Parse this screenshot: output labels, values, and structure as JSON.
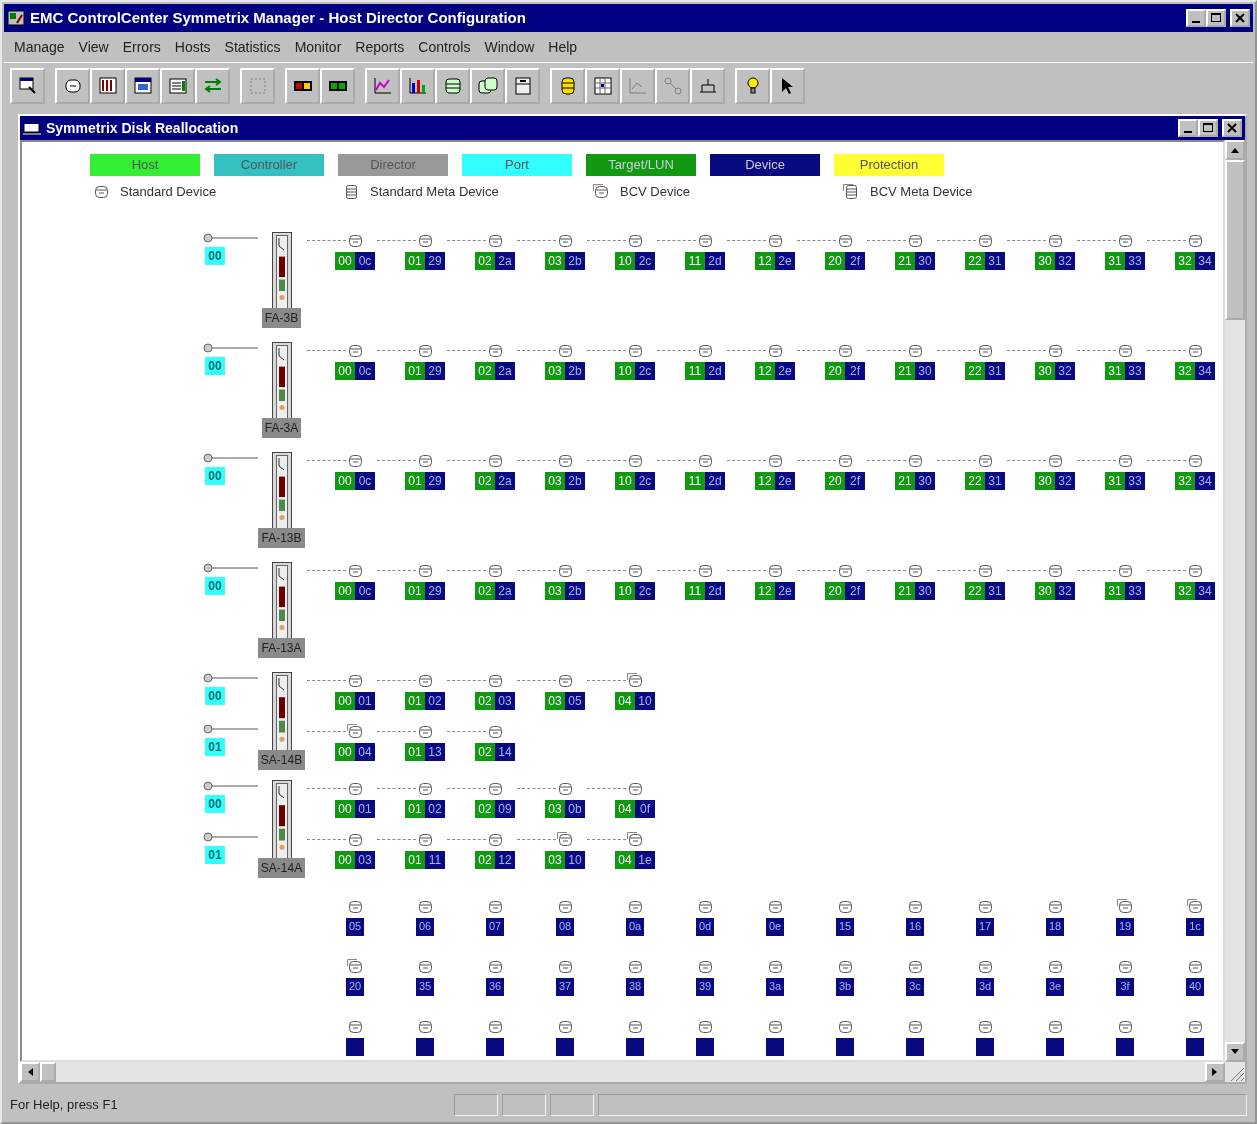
{
  "window": {
    "title": "EMC ControlCenter Symmetrix Manager - Host Director Configuration"
  },
  "menu": [
    "Manage",
    "View",
    "Errors",
    "Hosts",
    "Statistics",
    "Monitor",
    "Reports",
    "Controls",
    "Window",
    "Help"
  ],
  "toolbar": [
    [
      {
        "disabled": false
      }
    ],
    [
      {
        "disabled": false
      },
      {
        "disabled": false
      },
      {
        "disabled": false
      },
      {
        "disabled": false
      },
      {
        "disabled": false
      }
    ],
    [
      {
        "disabled": true
      }
    ],
    [
      {
        "disabled": false
      },
      {
        "disabled": false
      }
    ],
    [
      {
        "disabled": false
      },
      {
        "disabled": false
      },
      {
        "disabled": false
      },
      {
        "disabled": false
      },
      {
        "disabled": false
      }
    ],
    [
      {
        "disabled": false
      },
      {
        "disabled": false
      },
      {
        "disabled": true
      },
      {
        "disabled": true
      },
      {
        "disabled": false
      }
    ],
    [
      {
        "disabled": false
      },
      {
        "disabled": false
      }
    ]
  ],
  "child_window": {
    "title": "Symmetrix Disk Reallocation"
  },
  "legend": {
    "colors": [
      {
        "label": "Host",
        "color": "#33ee33"
      },
      {
        "label": "Controller",
        "color": "#33c0c0"
      },
      {
        "label": "Director",
        "color": "#999999"
      },
      {
        "label": "Port",
        "color": "#33ffff"
      },
      {
        "label": "Target/LUN",
        "color": "#119911"
      },
      {
        "label": "Device",
        "color": "#0a0a80"
      },
      {
        "label": "Protection",
        "color": "#ffff33"
      }
    ],
    "symbols": [
      {
        "kind": "standard",
        "label": "Standard Device"
      },
      {
        "kind": "standard_meta",
        "label": "Standard Meta Device"
      },
      {
        "kind": "bcv",
        "label": "BCV Device"
      },
      {
        "kind": "bcv_meta",
        "label": "BCV Meta Device"
      }
    ]
  },
  "directors": [
    {
      "name": "FA-3B",
      "ports": [
        {
          "label": "00",
          "devices": [
            {
              "kind": "standard",
              "target": "00",
              "device": "0c"
            },
            {
              "kind": "standard",
              "target": "01",
              "device": "29"
            },
            {
              "kind": "standard",
              "target": "02",
              "device": "2a"
            },
            {
              "kind": "standard",
              "target": "03",
              "device": "2b"
            },
            {
              "kind": "standard",
              "target": "10",
              "device": "2c"
            },
            {
              "kind": "standard",
              "target": "11",
              "device": "2d"
            },
            {
              "kind": "standard",
              "target": "12",
              "device": "2e"
            },
            {
              "kind": "standard",
              "target": "20",
              "device": "2f"
            },
            {
              "kind": "standard",
              "target": "21",
              "device": "30"
            },
            {
              "kind": "standard",
              "target": "22",
              "device": "31"
            },
            {
              "kind": "standard",
              "target": "30",
              "device": "32"
            },
            {
              "kind": "standard",
              "target": "31",
              "device": "33"
            },
            {
              "kind": "standard",
              "target": "32",
              "device": "34"
            }
          ]
        }
      ]
    },
    {
      "name": "FA-3A",
      "ports": [
        {
          "label": "00",
          "devices": [
            {
              "kind": "standard",
              "target": "00",
              "device": "0c"
            },
            {
              "kind": "standard",
              "target": "01",
              "device": "29"
            },
            {
              "kind": "standard",
              "target": "02",
              "device": "2a"
            },
            {
              "kind": "standard",
              "target": "03",
              "device": "2b"
            },
            {
              "kind": "standard",
              "target": "10",
              "device": "2c"
            },
            {
              "kind": "standard",
              "target": "11",
              "device": "2d"
            },
            {
              "kind": "standard",
              "target": "12",
              "device": "2e"
            },
            {
              "kind": "standard",
              "target": "20",
              "device": "2f"
            },
            {
              "kind": "standard",
              "target": "21",
              "device": "30"
            },
            {
              "kind": "standard",
              "target": "22",
              "device": "31"
            },
            {
              "kind": "standard",
              "target": "30",
              "device": "32"
            },
            {
              "kind": "standard",
              "target": "31",
              "device": "33"
            },
            {
              "kind": "standard",
              "target": "32",
              "device": "34"
            }
          ]
        }
      ]
    },
    {
      "name": "FA-13B",
      "ports": [
        {
          "label": "00",
          "devices": [
            {
              "kind": "standard",
              "target": "00",
              "device": "0c"
            },
            {
              "kind": "standard",
              "target": "01",
              "device": "29"
            },
            {
              "kind": "standard",
              "target": "02",
              "device": "2a"
            },
            {
              "kind": "standard",
              "target": "03",
              "device": "2b"
            },
            {
              "kind": "standard",
              "target": "10",
              "device": "2c"
            },
            {
              "kind": "standard",
              "target": "11",
              "device": "2d"
            },
            {
              "kind": "standard",
              "target": "12",
              "device": "2e"
            },
            {
              "kind": "standard",
              "target": "20",
              "device": "2f"
            },
            {
              "kind": "standard",
              "target": "21",
              "device": "30"
            },
            {
              "kind": "standard",
              "target": "22",
              "device": "31"
            },
            {
              "kind": "standard",
              "target": "30",
              "device": "32"
            },
            {
              "kind": "standard",
              "target": "31",
              "device": "33"
            },
            {
              "kind": "standard",
              "target": "32",
              "device": "34"
            }
          ]
        }
      ]
    },
    {
      "name": "FA-13A",
      "ports": [
        {
          "label": "00",
          "devices": [
            {
              "kind": "standard",
              "target": "00",
              "device": "0c"
            },
            {
              "kind": "standard",
              "target": "01",
              "device": "29"
            },
            {
              "kind": "standard",
              "target": "02",
              "device": "2a"
            },
            {
              "kind": "standard",
              "target": "03",
              "device": "2b"
            },
            {
              "kind": "standard",
              "target": "10",
              "device": "2c"
            },
            {
              "kind": "standard",
              "target": "11",
              "device": "2d"
            },
            {
              "kind": "standard",
              "target": "12",
              "device": "2e"
            },
            {
              "kind": "standard",
              "target": "20",
              "device": "2f"
            },
            {
              "kind": "standard",
              "target": "21",
              "device": "30"
            },
            {
              "kind": "standard",
              "target": "22",
              "device": "31"
            },
            {
              "kind": "standard",
              "target": "30",
              "device": "32"
            },
            {
              "kind": "standard",
              "target": "31",
              "device": "33"
            },
            {
              "kind": "standard",
              "target": "32",
              "device": "34"
            }
          ]
        }
      ]
    },
    {
      "name": "SA-14B",
      "ports": [
        {
          "label": "00",
          "devices": [
            {
              "kind": "standard",
              "target": "00",
              "device": "01"
            },
            {
              "kind": "standard",
              "target": "01",
              "device": "02"
            },
            {
              "kind": "standard",
              "target": "02",
              "device": "03"
            },
            {
              "kind": "standard",
              "target": "03",
              "device": "05"
            },
            {
              "kind": "bcv",
              "target": "04",
              "device": "10"
            }
          ]
        },
        {
          "label": "01",
          "devices": [
            {
              "kind": "bcv",
              "target": "00",
              "device": "04"
            },
            {
              "kind": "standard",
              "target": "01",
              "device": "13"
            },
            {
              "kind": "standard",
              "target": "02",
              "device": "14"
            }
          ]
        }
      ]
    },
    {
      "name": "SA-14A",
      "ports": [
        {
          "label": "00",
          "devices": [
            {
              "kind": "standard",
              "target": "00",
              "device": "01"
            },
            {
              "kind": "standard",
              "target": "01",
              "device": "02"
            },
            {
              "kind": "standard",
              "target": "02",
              "device": "09"
            },
            {
              "kind": "standard",
              "target": "03",
              "device": "0b"
            },
            {
              "kind": "standard",
              "target": "04",
              "device": "0f"
            }
          ]
        },
        {
          "label": "01",
          "devices": [
            {
              "kind": "standard",
              "target": "00",
              "device": "03"
            },
            {
              "kind": "standard",
              "target": "01",
              "device": "11"
            },
            {
              "kind": "standard",
              "target": "02",
              "device": "12"
            },
            {
              "kind": "bcv",
              "target": "03",
              "device": "10"
            },
            {
              "kind": "bcv",
              "target": "04",
              "device": "1e"
            }
          ]
        }
      ]
    }
  ],
  "unassigned": [
    [
      {
        "kind": "standard",
        "device": "05"
      },
      {
        "kind": "standard",
        "device": "06"
      },
      {
        "kind": "standard",
        "device": "07"
      },
      {
        "kind": "standard",
        "device": "08"
      },
      {
        "kind": "standard",
        "device": "0a"
      },
      {
        "kind": "standard",
        "device": "0d"
      },
      {
        "kind": "standard",
        "device": "0e"
      },
      {
        "kind": "standard",
        "device": "15"
      },
      {
        "kind": "standard",
        "device": "16"
      },
      {
        "kind": "standard",
        "device": "17"
      },
      {
        "kind": "standard",
        "device": "18"
      },
      {
        "kind": "bcv",
        "device": "19"
      },
      {
        "kind": "bcv",
        "device": "1c"
      }
    ],
    [
      {
        "kind": "bcv",
        "device": "20"
      },
      {
        "kind": "standard",
        "device": "35"
      },
      {
        "kind": "standard",
        "device": "36"
      },
      {
        "kind": "standard",
        "device": "37"
      },
      {
        "kind": "standard",
        "device": "38"
      },
      {
        "kind": "standard",
        "device": "39"
      },
      {
        "kind": "standard",
        "device": "3a"
      },
      {
        "kind": "standard",
        "device": "3b"
      },
      {
        "kind": "standard",
        "device": "3c"
      },
      {
        "kind": "standard",
        "device": "3d"
      },
      {
        "kind": "standard",
        "device": "3e"
      },
      {
        "kind": "standard",
        "device": "3f"
      },
      {
        "kind": "standard",
        "device": "40"
      }
    ],
    [
      {
        "kind": "standard"
      },
      {
        "kind": "standard"
      },
      {
        "kind": "standard"
      },
      {
        "kind": "standard"
      },
      {
        "kind": "standard"
      },
      {
        "kind": "standard"
      },
      {
        "kind": "standard"
      },
      {
        "kind": "standard"
      },
      {
        "kind": "standard"
      },
      {
        "kind": "standard"
      },
      {
        "kind": "standard"
      },
      {
        "kind": "standard"
      },
      {
        "kind": "standard"
      }
    ]
  ],
  "status_bar": {
    "text": "For Help, press F1"
  }
}
